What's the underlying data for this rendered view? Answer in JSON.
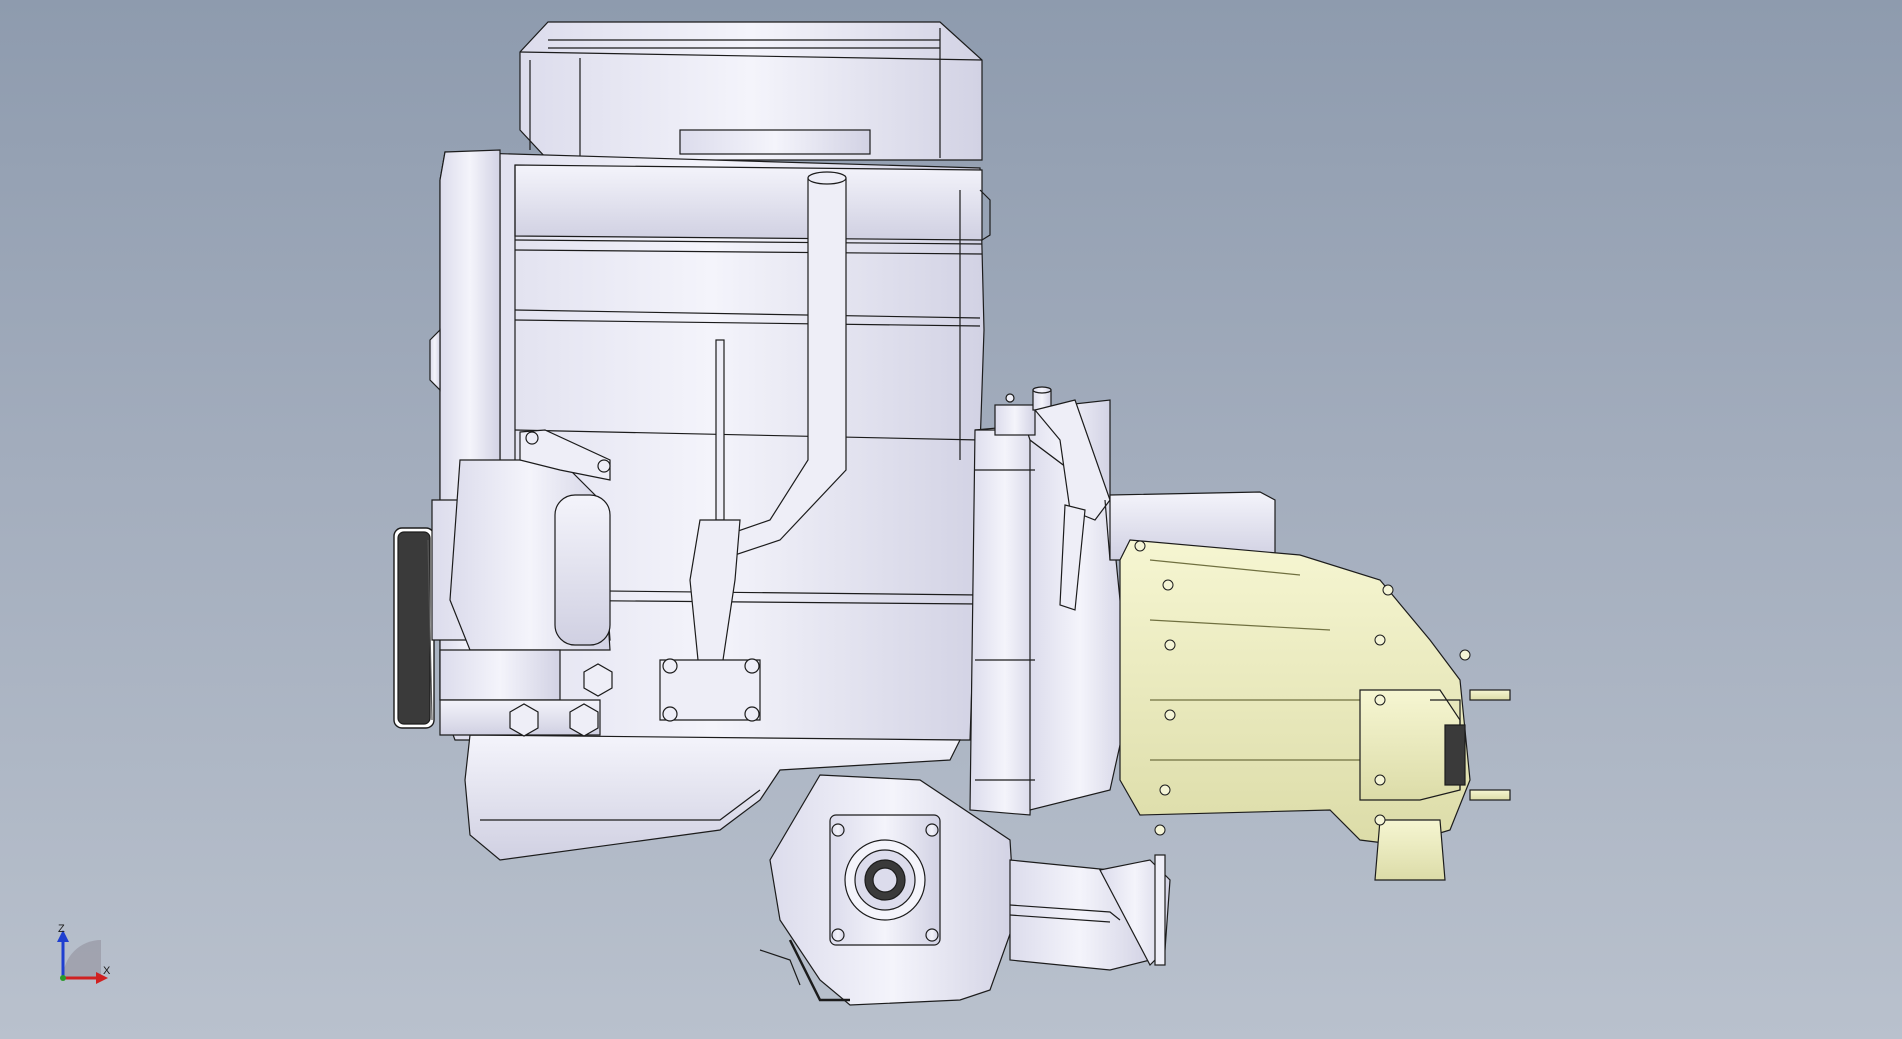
{
  "viewport": {
    "background_top": "#8e9bae",
    "background_bottom": "#b9c1cd"
  },
  "model": {
    "part_color": "#ededf6",
    "shade_color": "#c9c9dc",
    "edge_color": "#1c1c1c",
    "highlight_part_color": "#f1f1c4",
    "highlight_shade_color": "#d9d9a2"
  },
  "triad": {
    "z_label": "Z",
    "x_label": "X",
    "z_color": "#1f3fd0",
    "x_color": "#d02020",
    "y_color": "#2a9a2a"
  }
}
